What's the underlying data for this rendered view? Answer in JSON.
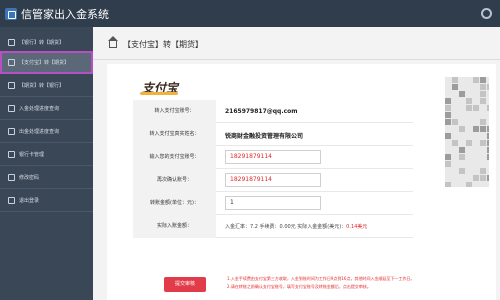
{
  "header": {
    "title": "信管家出入金系统"
  },
  "sidebar": {
    "items": [
      {
        "label": "【银行】转【期货】"
      },
      {
        "label": "【支付宝】转【期货】"
      },
      {
        "label": "【期货】转【银行】"
      },
      {
        "label": "入金处理进度查询"
      },
      {
        "label": "出金处理进度查询"
      },
      {
        "label": "银行卡管理"
      },
      {
        "label": "修改密码"
      },
      {
        "label": "退出登录"
      }
    ]
  },
  "breadcrumb": {
    "text": "【支付宝】转【期货】"
  },
  "logo": {
    "text": "支付宝"
  },
  "form": {
    "rows": [
      {
        "label": "转入支付宝账号：",
        "value": "2165979817@qq.com"
      },
      {
        "label": "转入支付宝真实姓名：",
        "value": "锐商财金融投资管理有限公司"
      },
      {
        "label": "输入您的支付宝账号：",
        "value": "18291879114"
      },
      {
        "label": "再次确认账号：",
        "value": "18291879114"
      },
      {
        "label": "转账金额(单位：元)：",
        "value": "1"
      },
      {
        "label": "实际入账金额：",
        "value_prefix": "入金汇率：7.2  手续费：0.00元  实际入金金额(美元)：",
        "value_amount": "0.14美元"
      }
    ]
  },
  "submit_label": "提交审核",
  "tips": {
    "line1": "1.入金手续费由支付宝第三方收取，入金到账时间为工作日9点到16点，其他时间入金顺延至下一工作日。",
    "line2": "2.请在转账之前确认支付宝账号，填写支付宝账号及转账金额后，点击提交审核。"
  },
  "colors": {
    "topbar": "#2f3d4c",
    "sidebar": "#3a4757",
    "active_outline": "#b84fc4",
    "submit": "#e23c4b",
    "accent_red": "#e02b2b"
  }
}
